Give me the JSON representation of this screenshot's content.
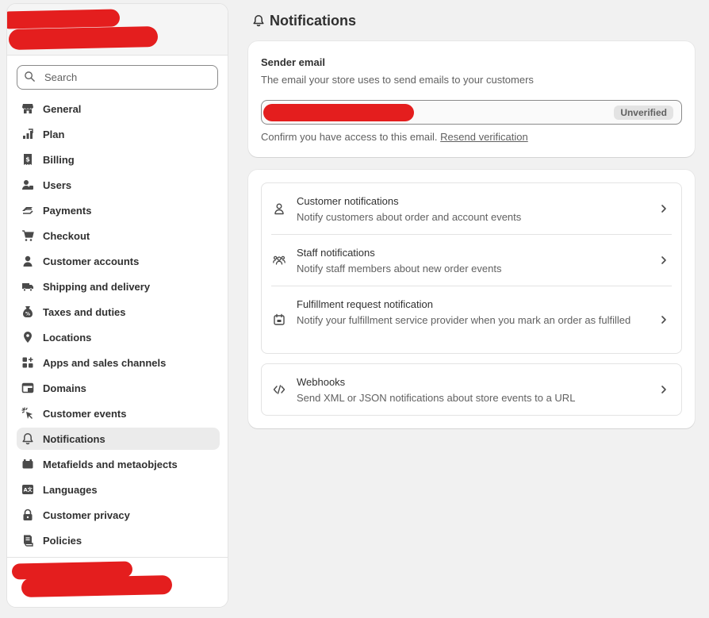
{
  "sidebar": {
    "search_placeholder": "Search",
    "items": [
      {
        "label": "General",
        "icon": "store-icon"
      },
      {
        "label": "Plan",
        "icon": "plan-icon"
      },
      {
        "label": "Billing",
        "icon": "billing-icon"
      },
      {
        "label": "Users",
        "icon": "users-icon"
      },
      {
        "label": "Payments",
        "icon": "payments-icon"
      },
      {
        "label": "Checkout",
        "icon": "cart-icon"
      },
      {
        "label": "Customer accounts",
        "icon": "person-icon"
      },
      {
        "label": "Shipping and delivery",
        "icon": "truck-icon"
      },
      {
        "label": "Taxes and duties",
        "icon": "tax-icon"
      },
      {
        "label": "Locations",
        "icon": "location-icon"
      },
      {
        "label": "Apps and sales channels",
        "icon": "apps-icon"
      },
      {
        "label": "Domains",
        "icon": "domains-icon"
      },
      {
        "label": "Customer events",
        "icon": "cursor-click-icon"
      },
      {
        "label": "Notifications",
        "icon": "bell-icon",
        "active": true
      },
      {
        "label": "Metafields and metaobjects",
        "icon": "metafields-icon"
      },
      {
        "label": "Languages",
        "icon": "languages-icon"
      },
      {
        "label": "Customer privacy",
        "icon": "lock-icon"
      },
      {
        "label": "Policies",
        "icon": "policies-icon"
      }
    ]
  },
  "page": {
    "title": "Notifications",
    "title_icon": "bell-icon"
  },
  "sender_card": {
    "title": "Sender email",
    "description": "The email your store uses to send emails to your customers",
    "status_badge": "Unverified",
    "confirm_text": "Confirm you have access to this email.",
    "resend_link": "Resend verification"
  },
  "notification_groups": {
    "customer": {
      "title": "Customer notifications",
      "description": "Notify customers about order and account events",
      "icon": "person-outline-icon"
    },
    "staff": {
      "title": "Staff notifications",
      "description": "Notify staff members about new order events",
      "icon": "team-icon"
    },
    "fulfillment": {
      "title": "Fulfillment request notification",
      "description": "Notify your fulfillment service provider when you mark an order as fulfilled",
      "icon": "fulfillment-icon"
    },
    "webhooks": {
      "title": "Webhooks",
      "description": "Send XML or JSON notifications about store events to a URL",
      "icon": "code-icon"
    }
  },
  "colors": {
    "redaction": "#e41e1e",
    "page_bg": "#f1f1f1",
    "active_nav_bg": "#ebebeb"
  }
}
